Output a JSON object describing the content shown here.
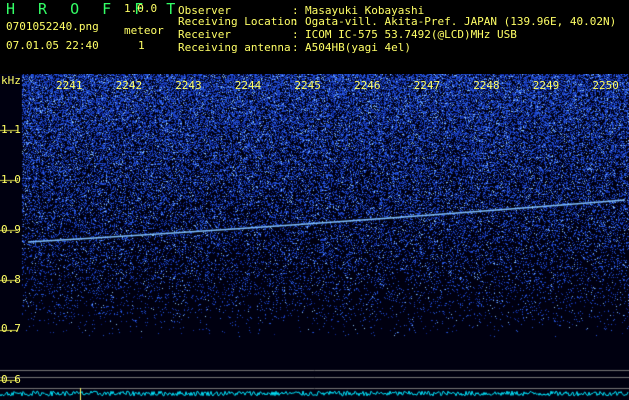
{
  "header": {
    "app_name": "H R O F F T",
    "version": "1.0.0",
    "file_name": "0701052240.png",
    "datetime": "07.01.05 22:40",
    "meteor_label": "meteor",
    "meteor_count": "1"
  },
  "station": [
    {
      "key": "Observer",
      "sep": ":",
      "value": "Masayuki Kobayashi"
    },
    {
      "key": "Receiving Location",
      "sep": ":",
      "value": "Ogata-vill. Akita-Pref. JAPAN (139.96E, 40.02N)"
    },
    {
      "key": "Receiver",
      "sep": ":",
      "value": "ICOM IC-575 53.7492(@LCD)MHz USB"
    },
    {
      "key": "Receiving antenna",
      "sep": ":",
      "value": "A504HB(yagi 4el)"
    }
  ],
  "spectrogram": {
    "y_unit": "kHz",
    "y_ticks": [
      "1.1",
      "1.0",
      "0.9",
      "0.8",
      "0.7",
      "0.6"
    ],
    "y_values": [
      1.1,
      1.0,
      0.9,
      0.8,
      0.7,
      0.6
    ],
    "x_ticks": [
      "2241",
      "2242",
      "2243",
      "2244",
      "2245",
      "2246",
      "2247",
      "2248",
      "2249",
      "2250"
    ],
    "colors": {
      "noise": "#1a33ff",
      "echo": "#88ccff",
      "axis": "#ffff66",
      "baseline": "#00ffff"
    }
  }
}
